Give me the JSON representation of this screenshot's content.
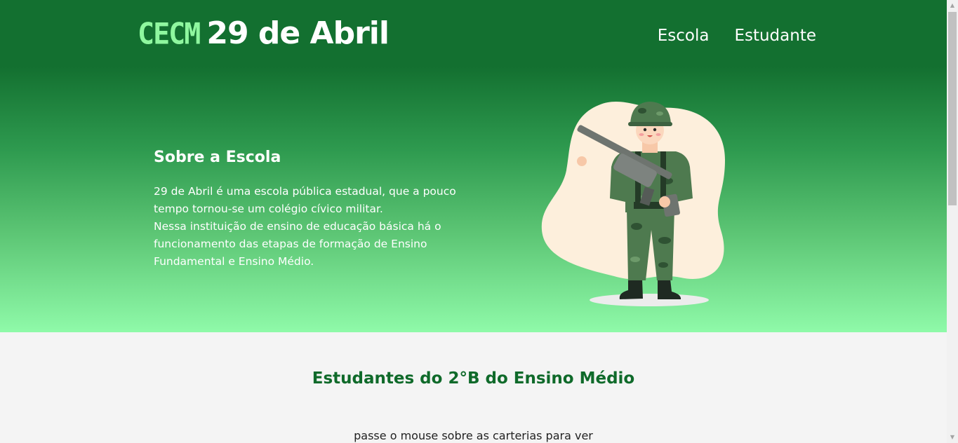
{
  "header": {
    "logo_prefix": "CECM",
    "logo_name": "29 de Abril",
    "nav": [
      {
        "label": "Escola"
      },
      {
        "label": "Estudante"
      }
    ]
  },
  "about": {
    "title": "Sobre a Escola",
    "line1": "29 de Abril é uma escola pública estadual, que a pouco tempo tornou-se um colégio cívico militar.",
    "line2": "Nessa instituição de ensino de educação básica há o funcionamento das etapas de formação de Ensino Fundamental e Ensino Médio."
  },
  "illustration": {
    "icon": "soldier-illustration"
  },
  "students": {
    "title": "Estudantes do 2°B do Ensino Médio",
    "hint": "passe o mouse sobre as carterias para ver"
  },
  "colors": {
    "header_green": "#137030",
    "hero_light_green": "#8ffaa9",
    "logo_accent": "#8ff79f",
    "section_title": "#0f6a2a"
  }
}
